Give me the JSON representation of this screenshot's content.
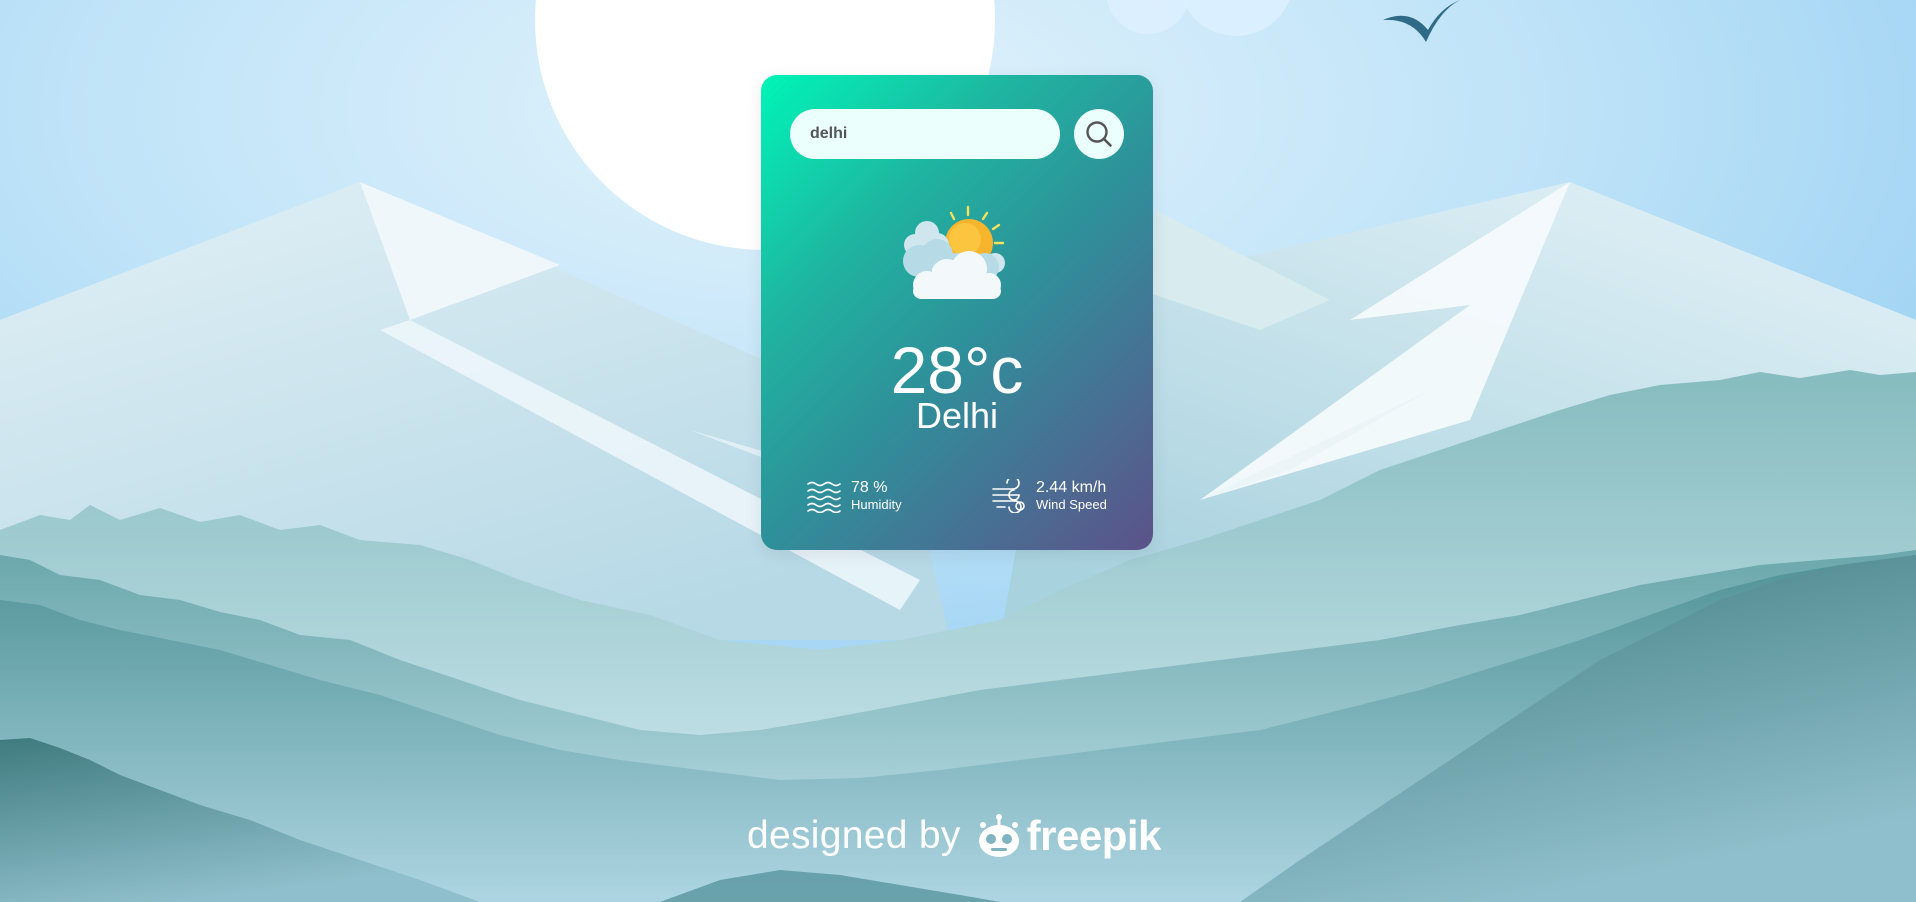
{
  "search": {
    "value": "delhi",
    "button_icon": "search-icon"
  },
  "weather": {
    "icon": "partly-cloudy-icon",
    "temperature": "28°c",
    "city": "Delhi",
    "humidity_value": "78 %",
    "humidity_label": "Humidity",
    "humidity_icon": "humidity-waves-icon",
    "wind_value": "2.44 km/h",
    "wind_label": "Wind Speed",
    "wind_icon": "wind-icon"
  },
  "footer": {
    "designed_by": "designed by",
    "brand": "freepik"
  },
  "colors": {
    "card_gradient_start": "#00f5b8",
    "card_gradient_end": "#5b5289",
    "search_bg": "#ebfffc",
    "sky": "#8fcbf0"
  }
}
